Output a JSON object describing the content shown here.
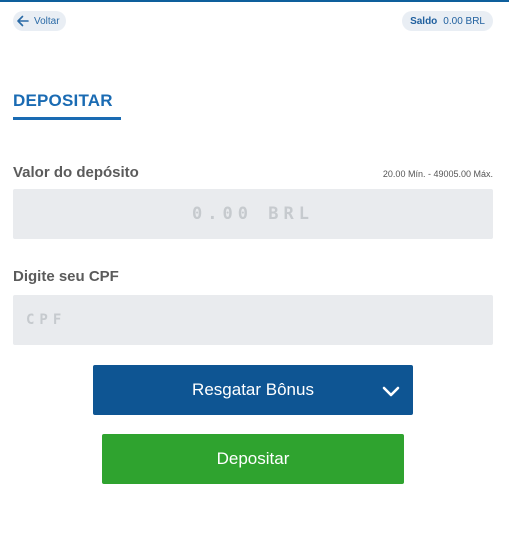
{
  "header": {
    "back_label": "Voltar",
    "balance_label": "Saldo",
    "balance_value": "0.00 BRL"
  },
  "tab": {
    "title": "DEPOSITAR"
  },
  "amount": {
    "label": "Valor do depósito",
    "limits": "20.00 Mín. - 49005.00 Máx.",
    "placeholder": "0.00 BRL"
  },
  "cpf": {
    "label": "Digite seu CPF",
    "placeholder": "CPF"
  },
  "bonus": {
    "label": "Resgatar Bônus"
  },
  "deposit": {
    "label": "Depositar"
  },
  "icons": {
    "back": "arrow-left-icon",
    "bonus_toggle": "chevron-down-icon"
  },
  "colors": {
    "accent": "#1a6bb3",
    "bonus_button": "#0e5593",
    "deposit_button": "#2fa32f",
    "field_background": "#e9ebee",
    "pill_background": "#e9eef4"
  }
}
